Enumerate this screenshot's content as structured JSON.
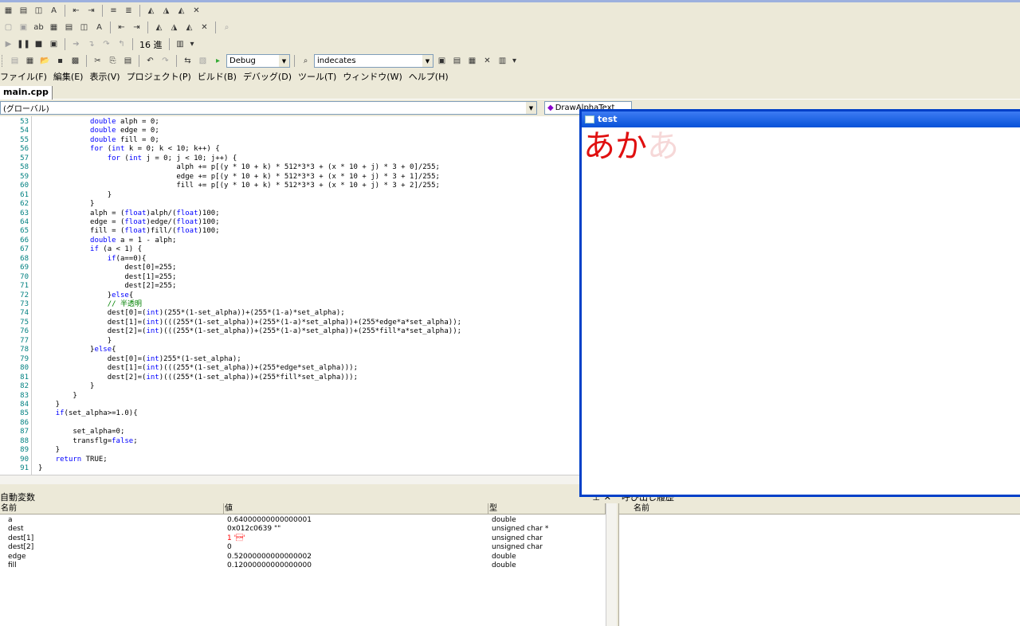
{
  "toolbar": {
    "hex_label": "16 進",
    "config_value": "Debug",
    "search_value": "indecates"
  },
  "menu": [
    "ファイル(F)",
    "編集(E)",
    "表示(V)",
    "プロジェクト(P)",
    "ビルド(B)",
    "デバッグ(D)",
    "ツール(T)",
    "ウィンドウ(W)",
    "ヘルプ(H)"
  ],
  "tabs": {
    "active": "main.cpp"
  },
  "scope": {
    "value": "(グローバル)",
    "member": "DrawAlphaText"
  },
  "code": {
    "lines": [
      {
        "n": "53",
        "t": "            double alph = 0;"
      },
      {
        "n": "54",
        "t": "            double edge = 0;"
      },
      {
        "n": "55",
        "t": "            double fill = 0;"
      },
      {
        "n": "56",
        "t": "            for (int k = 0; k < 10; k++) {"
      },
      {
        "n": "57",
        "t": "                for (int j = 0; j < 10; j++) {"
      },
      {
        "n": "58",
        "t": "                                alph += p[(y * 10 + k) * 512*3*3 + (x * 10 + j) * 3 + 0]/255;"
      },
      {
        "n": "59",
        "t": "                                edge += p[(y * 10 + k) * 512*3*3 + (x * 10 + j) * 3 + 1]/255;"
      },
      {
        "n": "60",
        "t": "                                fill += p[(y * 10 + k) * 512*3*3 + (x * 10 + j) * 3 + 2]/255;"
      },
      {
        "n": "61",
        "t": "                }"
      },
      {
        "n": "62",
        "t": "            }"
      },
      {
        "n": "63",
        "t": "            alph = (float)alph/(float)100;"
      },
      {
        "n": "64",
        "t": "            edge = (float)edge/(float)100;"
      },
      {
        "n": "65",
        "t": "            fill = (float)fill/(float)100;"
      },
      {
        "n": "66",
        "t": "            double a = 1 - alph;"
      },
      {
        "n": "67",
        "t": "            if (a < 1) {"
      },
      {
        "n": "68",
        "t": "                if(a==0){"
      },
      {
        "n": "69",
        "t": "                    dest[0]=255;"
      },
      {
        "n": "70",
        "t": "                    dest[1]=255;"
      },
      {
        "n": "71",
        "t": "                    dest[2]=255;"
      },
      {
        "n": "72",
        "t": "                }else{"
      },
      {
        "n": "73",
        "t": "                // 半透明"
      },
      {
        "n": "74",
        "t": "                dest[0]=(int)(255*(1-set_alpha))+(255*(1-a)*set_alpha);"
      },
      {
        "n": "75",
        "t": "                dest[1]=(int)(((255*(1-set_alpha))+(255*(1-a)*set_alpha))+(255*edge*a*set_alpha));"
      },
      {
        "n": "76",
        "t": "                dest[2]=(int)(((255*(1-set_alpha))+(255*(1-a)*set_alpha))+(255*fill*a*set_alpha));"
      },
      {
        "n": "77",
        "t": "                }"
      },
      {
        "n": "78",
        "t": "            }else{"
      },
      {
        "n": "79",
        "t": "                dest[0]=(int)255*(1-set_alpha);"
      },
      {
        "n": "80",
        "t": "                dest[1]=(int)(((255*(1-set_alpha))+(255*edge*set_alpha)));"
      },
      {
        "n": "81",
        "t": "                dest[2]=(int)(((255*(1-set_alpha))+(255*fill*set_alpha)));"
      },
      {
        "n": "82",
        "t": "            }"
      },
      {
        "n": "83",
        "t": "        }"
      },
      {
        "n": "84",
        "t": "    }"
      },
      {
        "n": "85",
        "t": "    if(set_alpha>=1.0){"
      },
      {
        "n": "86",
        "t": ""
      },
      {
        "n": "87",
        "t": "        set_alpha=0;"
      },
      {
        "n": "88",
        "t": "        transflg=false;"
      },
      {
        "n": "89",
        "t": "    }"
      },
      {
        "n": "90",
        "t": "    return TRUE;"
      },
      {
        "n": "91",
        "t": "}"
      }
    ]
  },
  "autos": {
    "title": "自動変数",
    "headers": {
      "name": "名前",
      "value": "値",
      "type": "型"
    },
    "rows": [
      {
        "name": "a",
        "value": "0.64000000000000001",
        "type": "double",
        "red": false
      },
      {
        "name": "dest",
        "value": "0x012c0639 \"\"",
        "type": "unsigned char *",
        "red": false
      },
      {
        "name": "dest[1]",
        "value": "1 '\u0001'",
        "type": "unsigned char",
        "red": true
      },
      {
        "name": "dest[2]",
        "value": "0",
        "type": "unsigned char",
        "red": false
      },
      {
        "name": "edge",
        "value": "0.52000000000000002",
        "type": "double",
        "red": false
      },
      {
        "name": "fill",
        "value": "0.12000000000000000",
        "type": "double",
        "red": false
      }
    ]
  },
  "callstack": {
    "title": "呼び出し履歴",
    "header": "名前"
  },
  "test_window": {
    "title": "test",
    "text_main": "あか",
    "text_faint": "あ",
    "text_color": "#e01010",
    "faint_color": "#f6d8d8"
  }
}
